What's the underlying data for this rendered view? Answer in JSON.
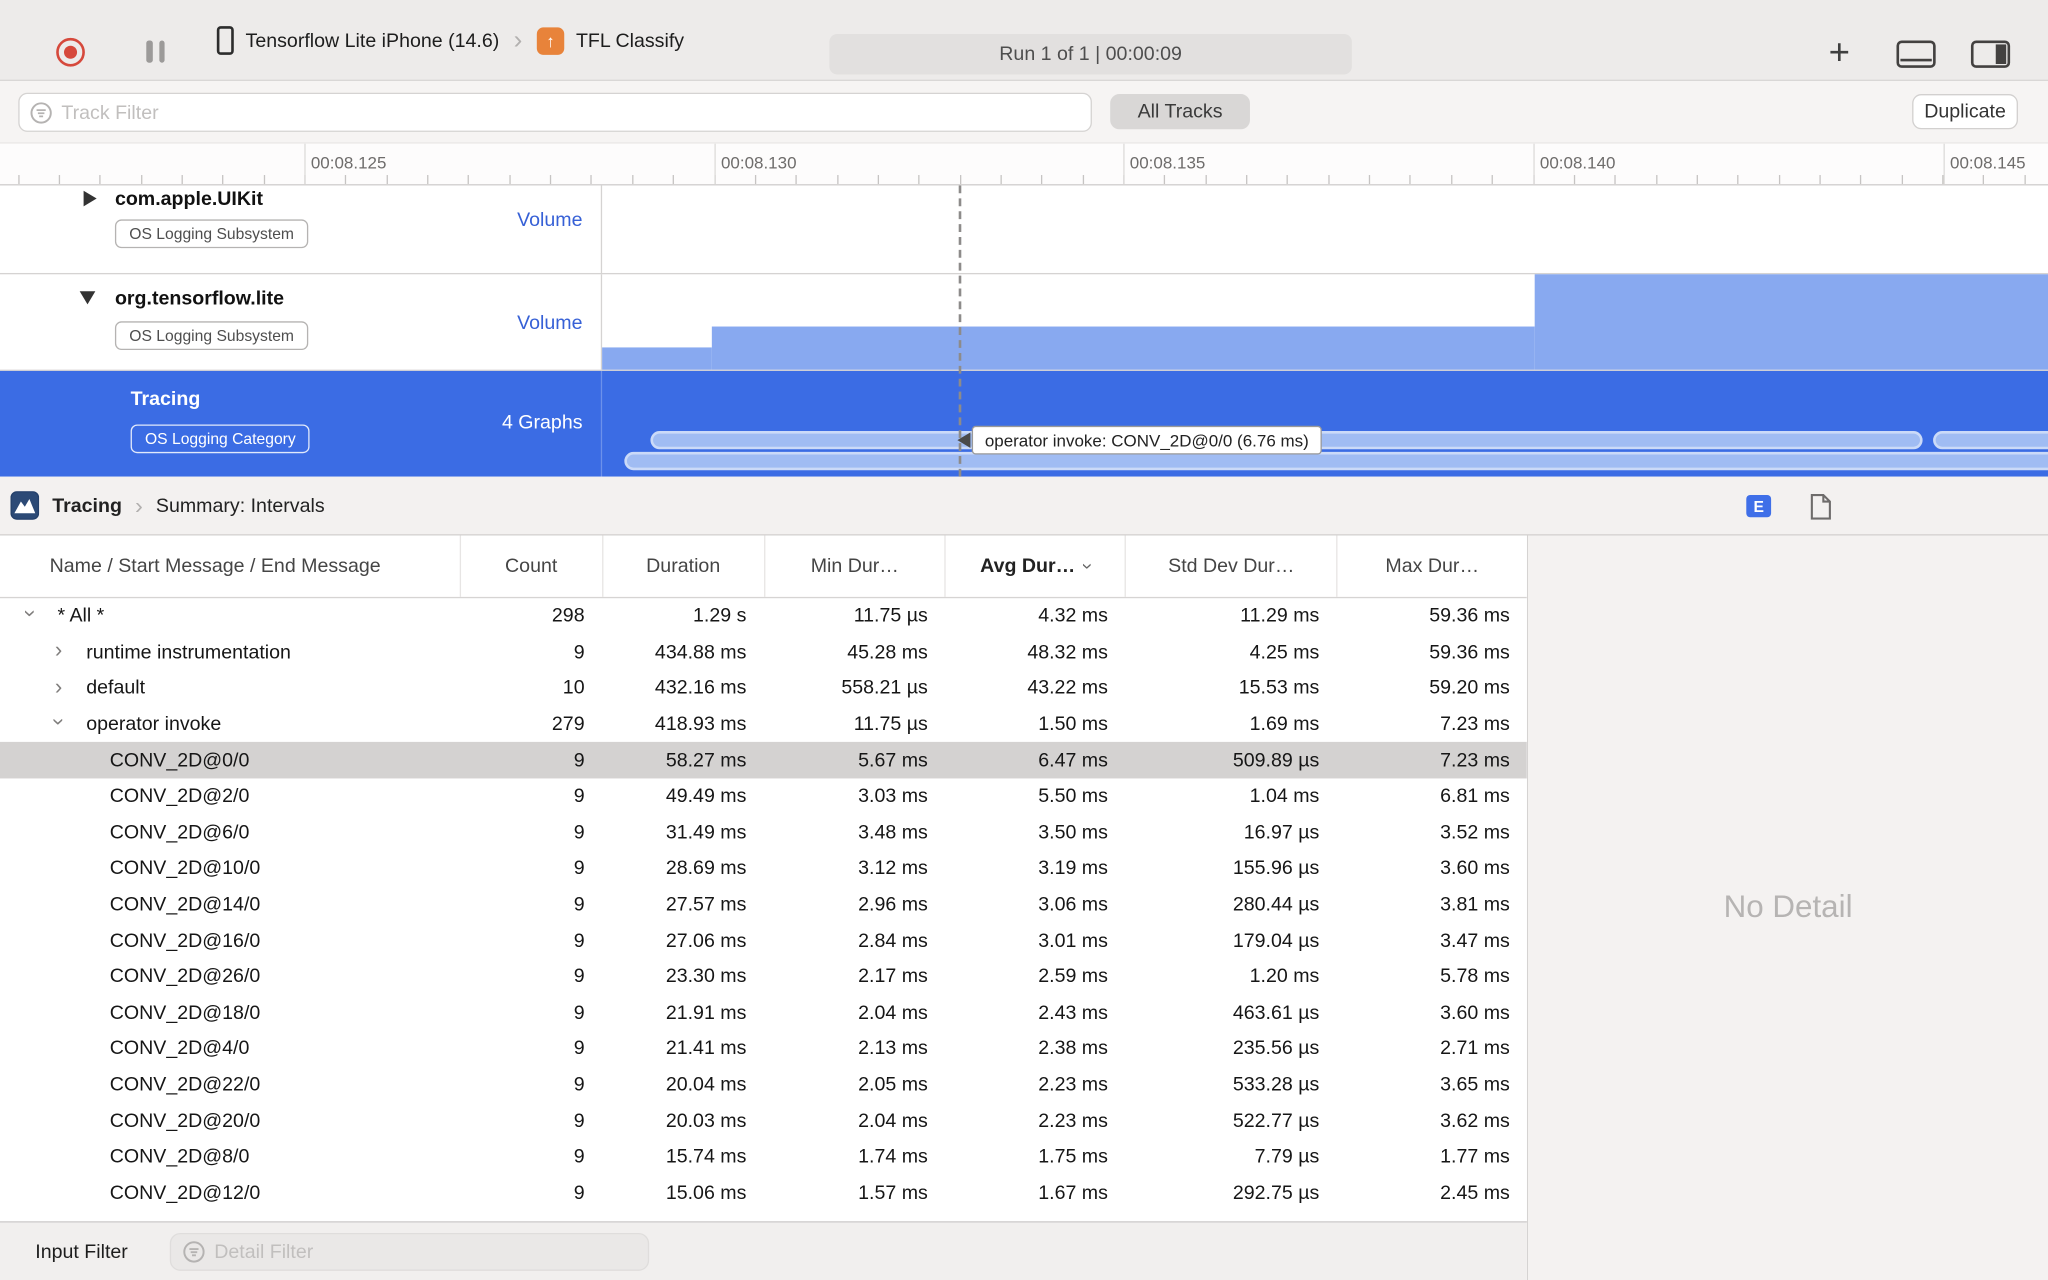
{
  "toolbar": {
    "device_name": "Tensorflow Lite iPhone (14.6)",
    "target_name": "TFL Classify",
    "run_status": "Run 1 of 1  |  00:00:09"
  },
  "filter_bar": {
    "track_filter_placeholder": "Track Filter",
    "all_tracks_label": "All Tracks",
    "duplicate_label": "Duplicate"
  },
  "ruler": {
    "tick_labels": [
      "00:08.125",
      "00:08.130",
      "00:08.135",
      "00:08.140",
      "00:08.145"
    ]
  },
  "tracks": [
    {
      "name": "com.apple.UIKit",
      "badge": "OS Logging Subsystem",
      "meta": "Volume",
      "selected": false
    },
    {
      "name": "org.tensorflow.lite",
      "badge": "OS Logging Subsystem",
      "meta": "Volume",
      "selected": false
    },
    {
      "name": "Tracing",
      "badge": "OS Logging Category",
      "meta": "4 Graphs",
      "selected": true,
      "tooltip": "operator invoke: CONV_2D@0/0 (6.76 ms)"
    }
  ],
  "detail_bar": {
    "instrument": "Tracing",
    "view": "Summary: Intervals",
    "e_button_label": "E"
  },
  "table": {
    "columns": [
      "Name / Start Message / End Message",
      "Count",
      "Duration",
      "Min Dur…",
      "Avg Dur…",
      "Std Dev Dur…",
      "Max Dur…"
    ],
    "sorted_column": "Avg Dur…",
    "rows": [
      {
        "name": "* All *",
        "level": 0,
        "disclosure": "expanded",
        "selected": false,
        "count": "298",
        "duration": "1.29 s",
        "min": "11.75 µs",
        "avg": "4.32 ms",
        "std": "11.29 ms",
        "max": "59.36 ms"
      },
      {
        "name": "runtime instrumentation",
        "level": 1,
        "disclosure": "collapsed",
        "selected": false,
        "count": "9",
        "duration": "434.88 ms",
        "min": "45.28 ms",
        "avg": "48.32 ms",
        "std": "4.25 ms",
        "max": "59.36 ms"
      },
      {
        "name": "default",
        "level": 1,
        "disclosure": "collapsed",
        "selected": false,
        "count": "10",
        "duration": "432.16 ms",
        "min": "558.21 µs",
        "avg": "43.22 ms",
        "std": "15.53 ms",
        "max": "59.20 ms"
      },
      {
        "name": "operator invoke",
        "level": 1,
        "disclosure": "expanded",
        "selected": false,
        "count": "279",
        "duration": "418.93 ms",
        "min": "11.75 µs",
        "avg": "1.50 ms",
        "std": "1.69 ms",
        "max": "7.23 ms"
      },
      {
        "name": "CONV_2D@0/0",
        "level": 2,
        "disclosure": "none",
        "selected": true,
        "count": "9",
        "duration": "58.27 ms",
        "min": "5.67 ms",
        "avg": "6.47 ms",
        "std": "509.89 µs",
        "max": "7.23 ms"
      },
      {
        "name": "CONV_2D@2/0",
        "level": 2,
        "disclosure": "none",
        "selected": false,
        "count": "9",
        "duration": "49.49 ms",
        "min": "3.03 ms",
        "avg": "5.50 ms",
        "std": "1.04 ms",
        "max": "6.81 ms"
      },
      {
        "name": "CONV_2D@6/0",
        "level": 2,
        "disclosure": "none",
        "selected": false,
        "count": "9",
        "duration": "31.49 ms",
        "min": "3.48 ms",
        "avg": "3.50 ms",
        "std": "16.97 µs",
        "max": "3.52 ms"
      },
      {
        "name": "CONV_2D@10/0",
        "level": 2,
        "disclosure": "none",
        "selected": false,
        "count": "9",
        "duration": "28.69 ms",
        "min": "3.12 ms",
        "avg": "3.19 ms",
        "std": "155.96 µs",
        "max": "3.60 ms"
      },
      {
        "name": "CONV_2D@14/0",
        "level": 2,
        "disclosure": "none",
        "selected": false,
        "count": "9",
        "duration": "27.57 ms",
        "min": "2.96 ms",
        "avg": "3.06 ms",
        "std": "280.44 µs",
        "max": "3.81 ms"
      },
      {
        "name": "CONV_2D@16/0",
        "level": 2,
        "disclosure": "none",
        "selected": false,
        "count": "9",
        "duration": "27.06 ms",
        "min": "2.84 ms",
        "avg": "3.01 ms",
        "std": "179.04 µs",
        "max": "3.47 ms"
      },
      {
        "name": "CONV_2D@26/0",
        "level": 2,
        "disclosure": "none",
        "selected": false,
        "count": "9",
        "duration": "23.30 ms",
        "min": "2.17 ms",
        "avg": "2.59 ms",
        "std": "1.20 ms",
        "max": "5.78 ms"
      },
      {
        "name": "CONV_2D@18/0",
        "level": 2,
        "disclosure": "none",
        "selected": false,
        "count": "9",
        "duration": "21.91 ms",
        "min": "2.04 ms",
        "avg": "2.43 ms",
        "std": "463.61 µs",
        "max": "3.60 ms"
      },
      {
        "name": "CONV_2D@4/0",
        "level": 2,
        "disclosure": "none",
        "selected": false,
        "count": "9",
        "duration": "21.41 ms",
        "min": "2.13 ms",
        "avg": "2.38 ms",
        "std": "235.56 µs",
        "max": "2.71 ms"
      },
      {
        "name": "CONV_2D@22/0",
        "level": 2,
        "disclosure": "none",
        "selected": false,
        "count": "9",
        "duration": "20.04 ms",
        "min": "2.05 ms",
        "avg": "2.23 ms",
        "std": "533.28 µs",
        "max": "3.65 ms"
      },
      {
        "name": "CONV_2D@20/0",
        "level": 2,
        "disclosure": "none",
        "selected": false,
        "count": "9",
        "duration": "20.03 ms",
        "min": "2.04 ms",
        "avg": "2.23 ms",
        "std": "522.77 µs",
        "max": "3.62 ms"
      },
      {
        "name": "CONV_2D@8/0",
        "level": 2,
        "disclosure": "none",
        "selected": false,
        "count": "9",
        "duration": "15.74 ms",
        "min": "1.74 ms",
        "avg": "1.75 ms",
        "std": "7.79 µs",
        "max": "1.77 ms"
      },
      {
        "name": "CONV_2D@12/0",
        "level": 2,
        "disclosure": "none",
        "selected": false,
        "count": "9",
        "duration": "15.06 ms",
        "min": "1.57 ms",
        "avg": "1.67 ms",
        "std": "292.75 µs",
        "max": "2.45 ms"
      }
    ]
  },
  "right_panel": {
    "empty_text": "No Detail"
  },
  "bottom_bar": {
    "label": "Input Filter",
    "detail_filter_placeholder": "Detail Filter"
  }
}
